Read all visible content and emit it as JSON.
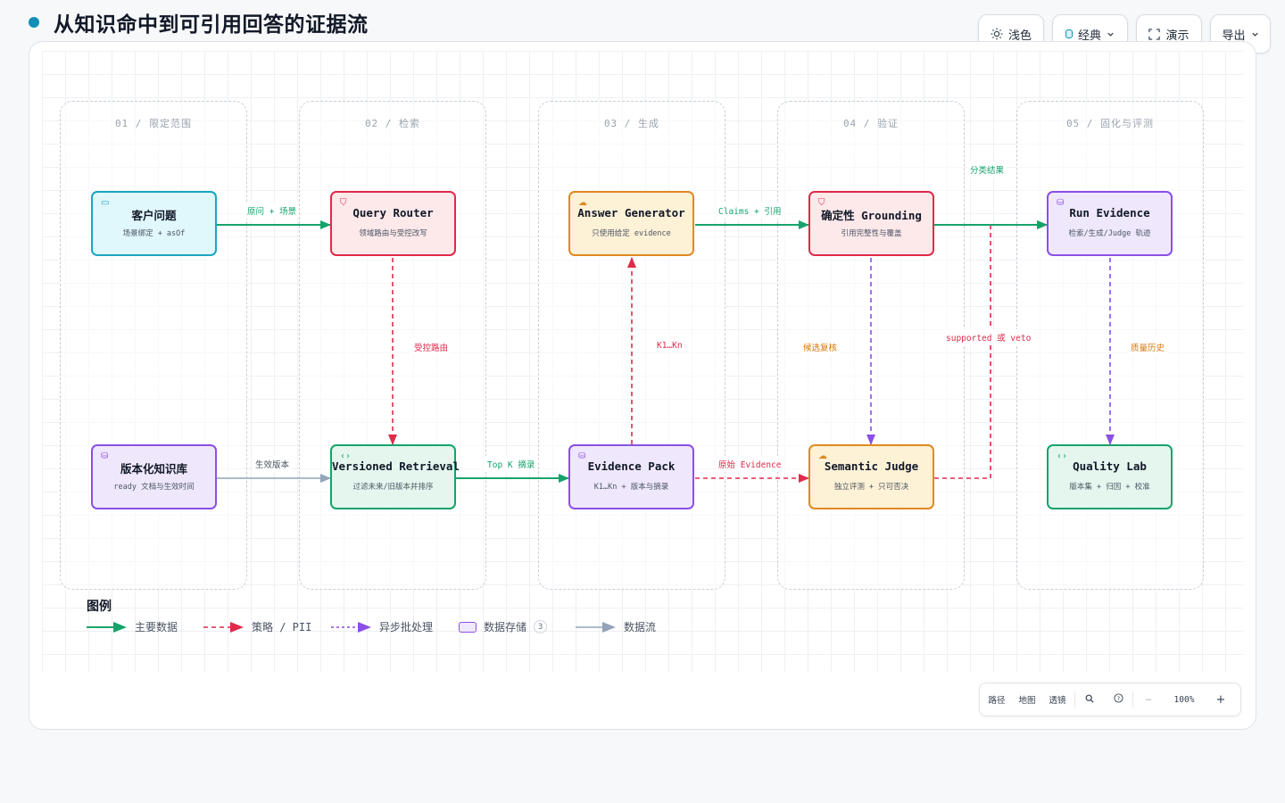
{
  "title": "从知识命中到可引用回答的证据流",
  "toolbar": {
    "theme_label": "浅色",
    "style_label": "经典",
    "present_label": "演示",
    "export_label": "导出"
  },
  "lanes": [
    "01 / 限定范围",
    "02 / 检索",
    "03 / 生成",
    "04 / 验证",
    "05 / 固化与评测"
  ],
  "nodes": {
    "client_question": {
      "title": "客户问题",
      "sub": "场景绑定 + asOf"
    },
    "knowledge_base": {
      "title": "版本化知识库",
      "sub": "ready 文档与生效时间"
    },
    "query_router": {
      "title": "Query Router",
      "sub": "领域路由与受控改写"
    },
    "versioned_retrieval": {
      "title": "Versioned Retrieval",
      "sub": "过滤未来/旧版本并排序"
    },
    "answer_generator": {
      "title": "Answer Generator",
      "sub": "只使用给定 evidence"
    },
    "evidence_pack": {
      "title": "Evidence Pack",
      "sub": "K1…Kn + 版本与摘录"
    },
    "grounding": {
      "title": "确定性 Grounding",
      "sub": "引用完整性与覆盖"
    },
    "semantic_judge": {
      "title": "Semantic Judge",
      "sub": "独立评测 + 只可否决"
    },
    "run_evidence": {
      "title": "Run Evidence",
      "sub": "检索/生成/Judge 轨迹"
    },
    "quality_lab": {
      "title": "Quality Lab",
      "sub": "版本集 + 归因 + 校准"
    }
  },
  "edges": {
    "client_to_router": "原问 + 场景",
    "kb_to_retrieval": "生效版本",
    "router_to_retrieval": "受控路由",
    "retrieval_to_pack": "Top K 摘录",
    "pack_to_generator": "K1…Kn",
    "generator_to_grounding": "Claims + 引用",
    "pack_to_judge": "原始 Evidence",
    "grounding_to_judge": "候选复核",
    "judge_to_run": "supported 或 veto",
    "grounding_to_run": "分类结果",
    "run_to_quality": "质量历史"
  },
  "legend": {
    "title": "图例",
    "items": [
      "主要数据",
      "策略 / PII",
      "异步批处理",
      "数据存储",
      "数据流"
    ],
    "store_count": "3"
  },
  "zoombar": {
    "path": "路径",
    "map": "地图",
    "lens": "透镜",
    "level": "100%",
    "minus": "−",
    "plus": "+"
  },
  "colors": {
    "primary": "#16a36b",
    "policy": "#e02a4a",
    "async": "#8b4fe6",
    "flow": "#94a3b8",
    "accent": "#0e8fb5"
  }
}
